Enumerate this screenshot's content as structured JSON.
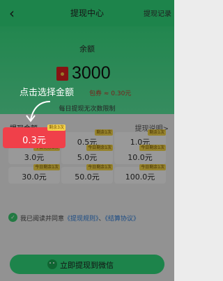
{
  "header": {
    "back_symbol": "‹",
    "title": "提现中心",
    "record_link": "提现记录"
  },
  "balance": {
    "label": "余额",
    "value": "3000",
    "note": "包券 ≈ 0.30元",
    "icon": "red-envelope-icon",
    "limit_text": "每日提现无次数限制"
  },
  "hint": {
    "text": "点击选择金额"
  },
  "section": {
    "label": "提现金额",
    "rules_link": "提现说明>"
  },
  "amounts": [
    {
      "amount": "0.3元",
      "badge": "剩余3次",
      "selected": true
    },
    {
      "amount": "0.5元",
      "badge": "剩余1次",
      "selected": false
    },
    {
      "amount": "1.0元",
      "badge": "剩余1次",
      "selected": false
    },
    {
      "amount": "3.0元",
      "badge": "今日剩余1次",
      "selected": false
    },
    {
      "amount": "5.0元",
      "badge": "今日剩余1次",
      "selected": false
    },
    {
      "amount": "10.0元",
      "badge": "今日剩余1次",
      "selected": false
    },
    {
      "amount": "30.0元",
      "badge": "今日剩余1次",
      "selected": false
    },
    {
      "amount": "50.0元",
      "badge": "今日剩余1次",
      "selected": false
    },
    {
      "amount": "100.0元",
      "badge": "今日剩余1次",
      "selected": false
    }
  ],
  "agreement": {
    "prefix": "我已阅读并同意",
    "rules": "《提现规则》",
    "sep": "、",
    "terms": "《结算协议》"
  },
  "submit": {
    "label": "立即提现到微信"
  },
  "colors": {
    "brand_green": "#2fd67a",
    "selected_red": "#f0404a",
    "badge_yellow": "#f3d34a"
  }
}
